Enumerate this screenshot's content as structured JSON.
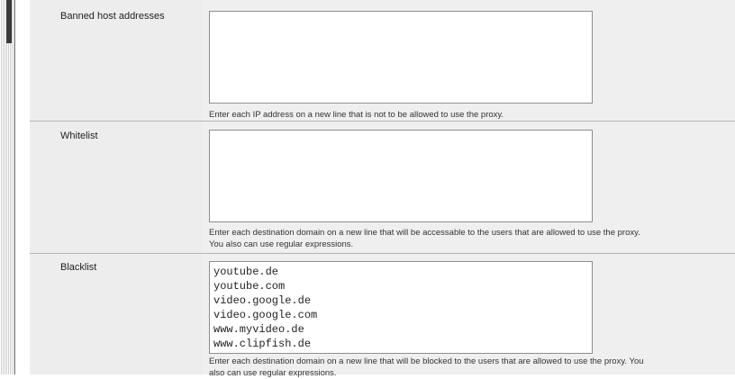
{
  "sections": {
    "banned": {
      "label": "Banned host addresses",
      "value": "",
      "help": "Enter each IP address on a new line that is not to be allowed to use the proxy."
    },
    "whitelist": {
      "label": "Whitelist",
      "value": "",
      "help_line1": "Enter each destination domain on a new line that will be accessable to the users that are allowed to use the proxy.",
      "help_line2": "You also can use regular expressions."
    },
    "blacklist": {
      "label": "Blacklist",
      "value": "youtube.de\nyoutube.com\nvideo.google.de\nvideo.google.com\nwww.myvideo.de\nwww.clipfish.de",
      "help_line1": "Enter each destination domain on a new line that will be blocked to the users that are allowed to use the proxy. You",
      "help_line2": "also can use regular expressions."
    }
  }
}
